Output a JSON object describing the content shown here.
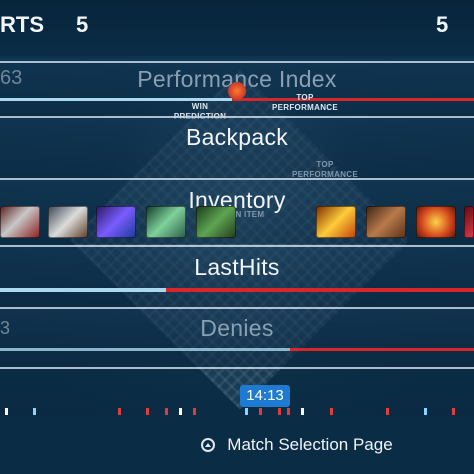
{
  "header": {
    "team_left_label": "RTS",
    "score_left": "5",
    "score_right": "5"
  },
  "rows": {
    "performance": {
      "title": "Performance Index",
      "left_value": "63",
      "win_prediction": "WIN PREDICTION",
      "top_performance": "TOP\nPERFORMANCE"
    },
    "backpack": {
      "title": "Backpack",
      "top_performance": "TOP\nPERFORMANCE"
    },
    "inventory": {
      "title": "Inventory",
      "sub_label": "WN ITEM"
    },
    "lasthits": {
      "title": "LastHits",
      "blue_share": 0.35
    },
    "denies": {
      "title": "Denies",
      "left_value": "3"
    }
  },
  "inventory_left_icons": [
    "blood-axe-icon",
    "battle-axe-icon",
    "purple-claw-icon",
    "green-dagger-icon",
    "green-skull-icon"
  ],
  "inventory_right_icons": [
    "fire-sword-icon",
    "boots-icon",
    "fire-orb-icon",
    "red-gem-icon"
  ],
  "timeline": {
    "clock": "14:13",
    "ticks": [
      {
        "pos": 0.01,
        "color": "#ffffff"
      },
      {
        "pos": 0.07,
        "color": "#8ad3ff"
      },
      {
        "pos": 0.25,
        "color": "#e23b3b"
      },
      {
        "pos": 0.31,
        "color": "#e23b3b"
      },
      {
        "pos": 0.35,
        "color": "#e23b3b"
      },
      {
        "pos": 0.38,
        "color": "#ffffff"
      },
      {
        "pos": 0.41,
        "color": "#e23b3b"
      },
      {
        "pos": 0.52,
        "color": "#8ad3ff"
      },
      {
        "pos": 0.55,
        "color": "#e23b3b"
      },
      {
        "pos": 0.59,
        "color": "#e23b3b"
      },
      {
        "pos": 0.61,
        "color": "#e23b3b"
      },
      {
        "pos": 0.64,
        "color": "#ffffff"
      },
      {
        "pos": 0.7,
        "color": "#e23b3b"
      },
      {
        "pos": 0.82,
        "color": "#e23b3b"
      },
      {
        "pos": 0.9,
        "color": "#8ad3ff"
      },
      {
        "pos": 0.96,
        "color": "#e23b3b"
      }
    ]
  },
  "footer": {
    "button_label": "Match Selection Page"
  },
  "colors": {
    "blue": "#a9d8ef",
    "red": "#d8262b"
  }
}
